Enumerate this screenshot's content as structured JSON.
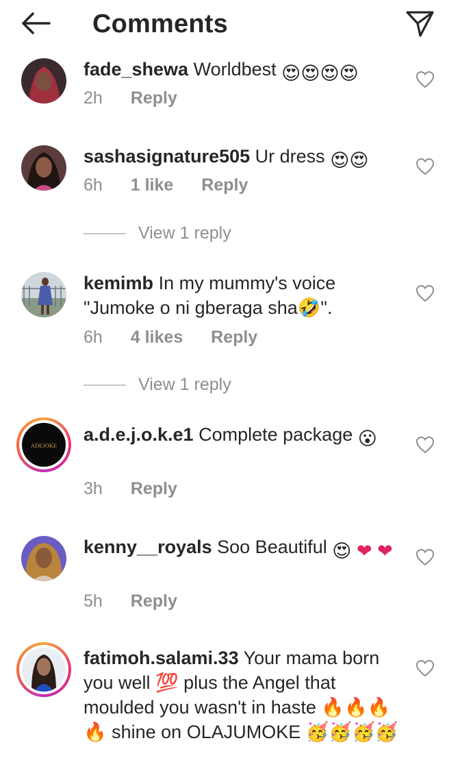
{
  "header": {
    "title": "Comments"
  },
  "comments": [
    {
      "username": "fade_shewa",
      "text": "Worldbest",
      "emojis": "😍😍😍😍",
      "time": "2h",
      "likes": "",
      "reply": "Reply"
    },
    {
      "username": "sashasignature505",
      "text": "Ur dress",
      "emojis": "😍😍",
      "time": "6h",
      "likes": "1 like",
      "reply": "Reply",
      "view_replies": "View 1 reply"
    },
    {
      "username": "kemimb",
      "text": "In my mummy's voice \"Jumoke o ni gberaga sha🤣\".",
      "time": "6h",
      "likes": "4 likes",
      "reply": "Reply",
      "view_replies": "View 1 reply"
    },
    {
      "username": "a.d.e.j.o.k.e1",
      "text": "Complete package",
      "emojis": "😮",
      "time": "3h",
      "likes": "",
      "reply": "Reply",
      "avatar_text": "ADEJOKE"
    },
    {
      "username": "kenny__royals",
      "text": "Soo Beautiful",
      "emojis": "😍 ❤️ ❤️",
      "time": "5h",
      "likes": "",
      "reply": "Reply"
    },
    {
      "username": "fatimoh.salami.33",
      "text": "Your mama born you well 💯 plus the Angel that moulded you wasn't in haste 🔥🔥🔥🔥 shine on OLAJUMOKE 🥳🥳🥳🥳"
    }
  ],
  "icons": {
    "back": "arrow-left-icon",
    "send": "paper-plane-icon",
    "like": "heart-outline-icon"
  },
  "colors": {
    "text": "#262626",
    "muted": "#8e8e8e",
    "heart_emoji": "#e0245e"
  }
}
